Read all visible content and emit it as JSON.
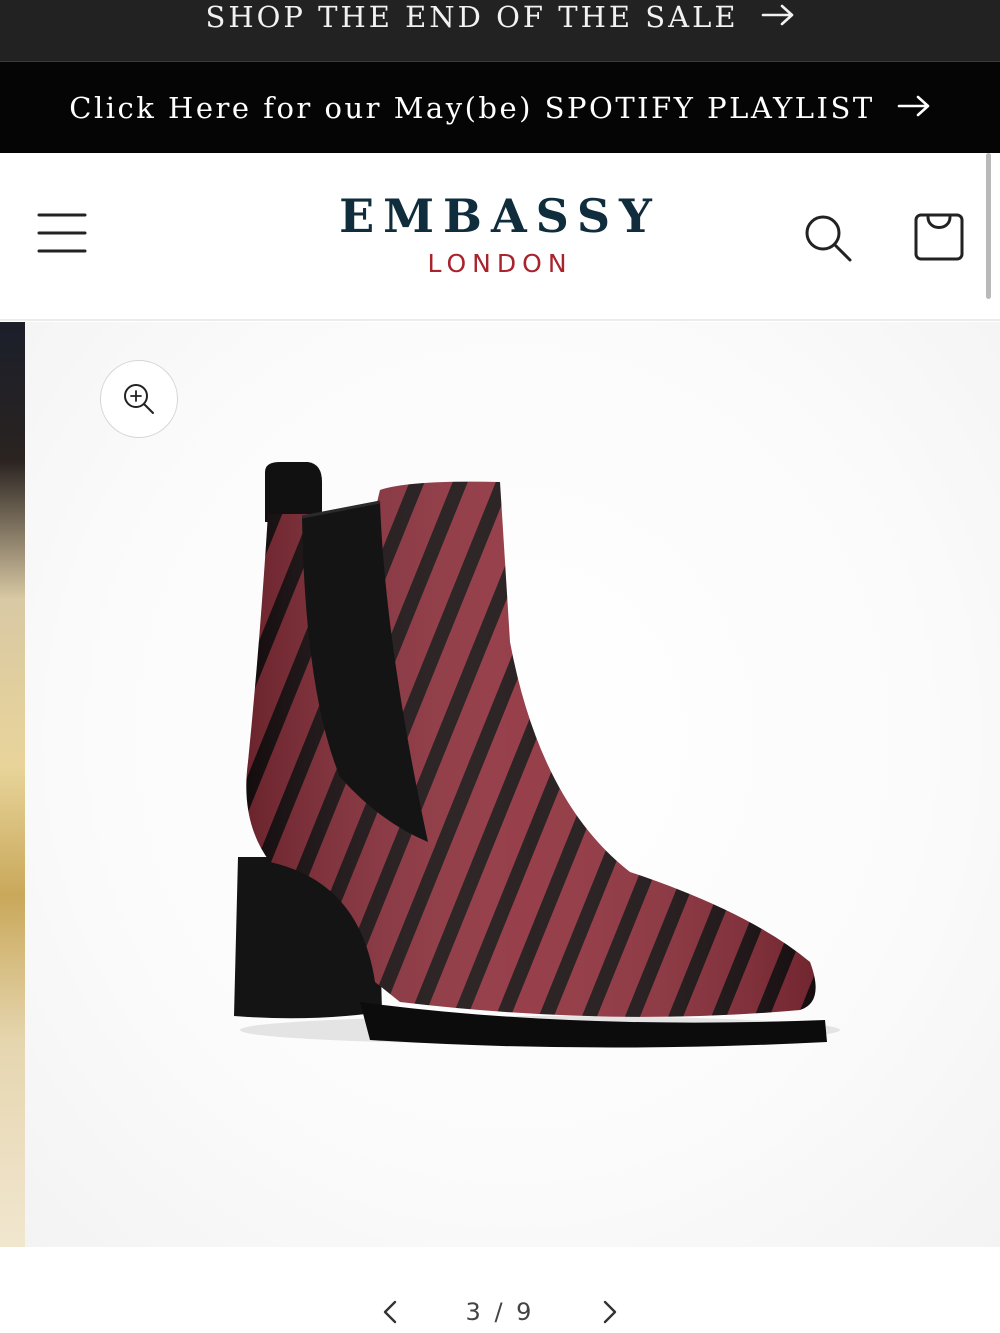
{
  "announcements": {
    "sale_text": "SHOP THE END OF THE SALE",
    "playlist_text": "Click Here for our May(be) SPOTIFY PLAYLIST"
  },
  "header": {
    "logo_main": "EMBASSY",
    "logo_sub": "LONDON",
    "icons": [
      "menu-icon",
      "search-icon",
      "cart-icon"
    ]
  },
  "gallery": {
    "current": "3",
    "total": "9",
    "counter_text": "3 / 9",
    "icons": [
      "zoom-in-icon",
      "chevron-left-icon",
      "chevron-right-icon"
    ]
  },
  "colors": {
    "sale_bar": "#222222",
    "playlist_bar": "#050505",
    "logo_main": "#0f2d3c",
    "logo_sub": "#a8232c",
    "boot_base": "#8e2f3b",
    "boot_stripe": "#1a1012"
  }
}
